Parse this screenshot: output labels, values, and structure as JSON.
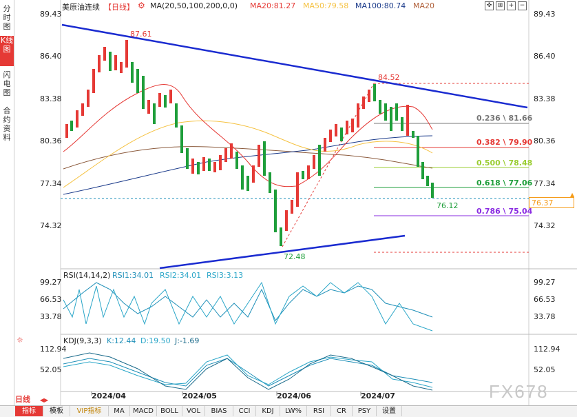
{
  "left_tabs": [
    "分时图",
    "K线图",
    "闪电图",
    "合约资料"
  ],
  "header": {
    "symbol": "美原油连续",
    "period": "【日线】",
    "ma_label": "MA(20,50,100,200,0,0)",
    "ma20": "MA20:81.27",
    "ma50": "MA50:79.58",
    "ma100": "MA100:80.74",
    "ma20b": "MA20",
    "colors": {
      "ma20": "#e53935",
      "ma50": "#f5c242",
      "ma100": "#1a3a8a",
      "ma200": "#8b5a3c"
    }
  },
  "price_axis": [
    "89.43",
    "86.40",
    "83.38",
    "80.36",
    "77.34",
    "74.32"
  ],
  "current_price": "76.37",
  "chart_labels": {
    "high": "87.61",
    "swing_high": "84.52",
    "low": "72.48",
    "last_low": "76.12"
  },
  "fib_levels": [
    {
      "label": "0.236 \\ 81.66",
      "color": "#777777"
    },
    {
      "label": "0.382 \\ 79.90",
      "color": "#e53935"
    },
    {
      "label": "0.500 \\ 78.48",
      "color": "#9acd32"
    },
    {
      "label": "0.618 \\ 77.06",
      "color": "#1e9e3a"
    },
    {
      "label": "0.786 \\ 75.04",
      "color": "#8a2be2"
    }
  ],
  "rsi": {
    "title": "RSI(14,14,2)",
    "rsi1": "RSI1:34.01",
    "rsi2": "RSI2:34.01",
    "rsi3": "RSI3:3.13",
    "axis": [
      "99.27",
      "66.53",
      "33.78"
    ]
  },
  "kdj": {
    "title": "KDJ(9,3,3)",
    "k": "K:12.44",
    "d": "D:19.50",
    "j": "J:-1.69",
    "axis": [
      "112.94",
      "52.05"
    ]
  },
  "dates": [
    "2024/04",
    "2024/05",
    "2024/06",
    "2024/07"
  ],
  "period_selector": "日线",
  "watermark": "FX678",
  "bottom_tabs": [
    "指标",
    "模板",
    "VIP指标",
    "MA",
    "MACD",
    "BOLL",
    "VOL",
    "BIAS",
    "CCI",
    "KDJ",
    "LW%",
    "RSI",
    "CR",
    "PSY",
    "设置"
  ]
}
